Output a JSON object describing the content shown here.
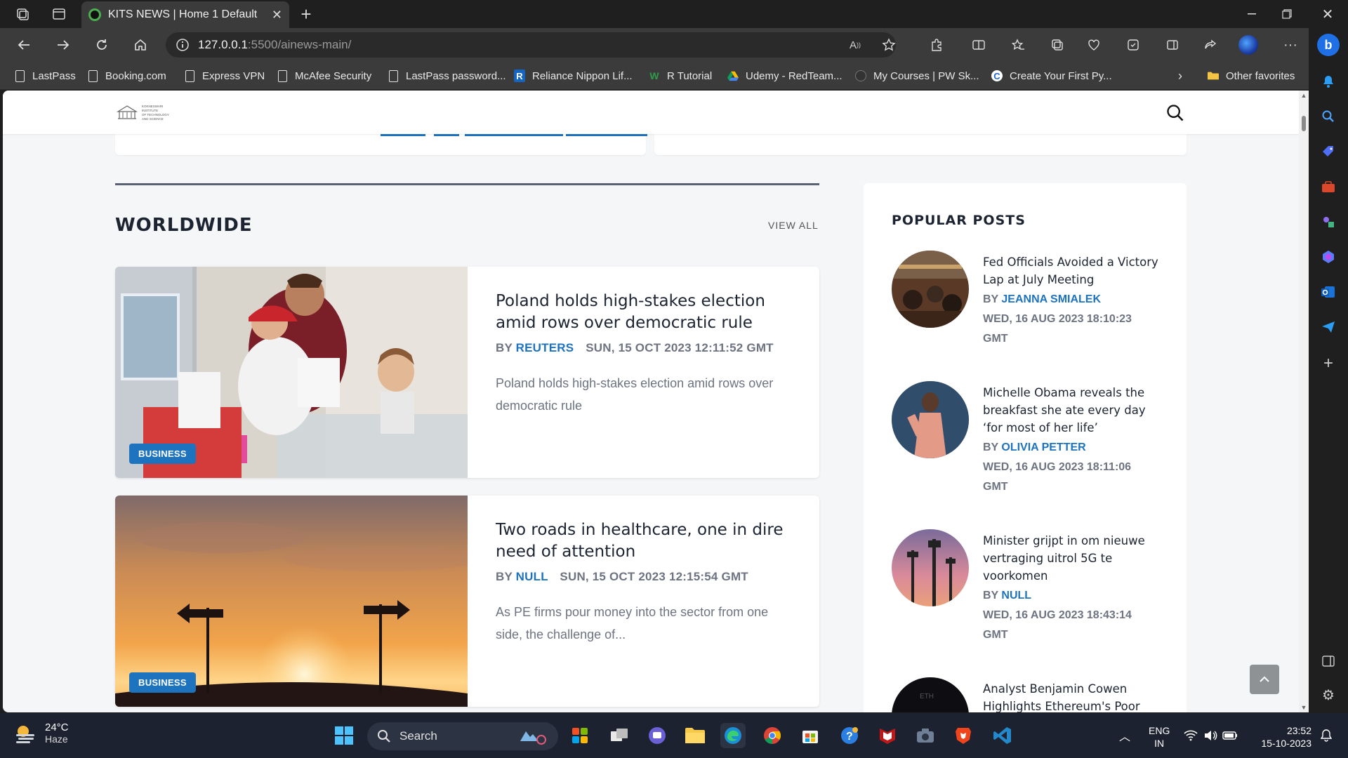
{
  "browser": {
    "tab_title": "KITS NEWS | Home 1 Default",
    "url_host": "127.0.0.1",
    "url_path": ":5500/ainews-main/",
    "bookmarks": [
      "LastPass",
      "Booking.com",
      "Express VPN",
      "McAfee Security",
      "LastPass password...",
      "Reliance Nippon Lif...",
      "R Tutorial",
      "Udemy - RedTeam...",
      "My Courses | PW Sk...",
      "Create Your First Py..."
    ],
    "other_favorites": "Other favorites"
  },
  "site": {
    "logo_lines": [
      "KOKNESWARI",
      "INSTITUTE",
      "OF TECHNOLOGY",
      "AND SCIENCE"
    ]
  },
  "worldwide": {
    "title": "WORLDWIDE",
    "view_all": "VIEW ALL",
    "articles": [
      {
        "category": "BUSINESS",
        "headline": "Poland holds high-stakes election amid rows over democratic rule",
        "by": "BY",
        "author": "REUTERS",
        "date": "SUN, 15 OCT 2023 12:11:52 GMT",
        "excerpt": "Poland holds high-stakes election amid rows over democratic rule"
      },
      {
        "category": "BUSINESS",
        "headline": "Two roads in healthcare, one in dire need of attention",
        "by": "BY",
        "author": "NULL",
        "date": "SUN, 15 OCT 2023 12:15:54 GMT",
        "excerpt": "As PE firms pour money into the sector from one side, the challenge of..."
      }
    ]
  },
  "popular": {
    "title": "POPULAR POSTS",
    "posts": [
      {
        "title": "Fed Officials Avoided a Victory Lap at July Meeting",
        "by": "BY",
        "author": "JEANNA SMIALEK",
        "date": "WED, 16 AUG 2023 18:10:23 GMT"
      },
      {
        "title": "Michelle Obama reveals the breakfast she ate every day ‘for most of her life’",
        "by": "BY",
        "author": "OLIVIA PETTER",
        "date": "WED, 16 AUG 2023 18:11:06 GMT"
      },
      {
        "title": "Minister grijpt in om nieuwe vertraging uitrol 5G te voorkomen",
        "by": "BY",
        "author": "NULL",
        "date": "WED, 16 AUG 2023 18:43:14 GMT"
      },
      {
        "title": "Analyst Benjamin Cowen Highlights Ethereum's Poor",
        "by": "",
        "author": "",
        "date": ""
      }
    ]
  },
  "taskbar": {
    "temperature": "24°C",
    "condition": "Haze",
    "search_label": "Search",
    "lang_line1": "ENG",
    "lang_line2": "IN",
    "time": "23:52",
    "date": "15-10-2023"
  },
  "colors": {
    "accent": "#1e73be",
    "heading": "#1c2331",
    "meta": "#6d7380"
  }
}
